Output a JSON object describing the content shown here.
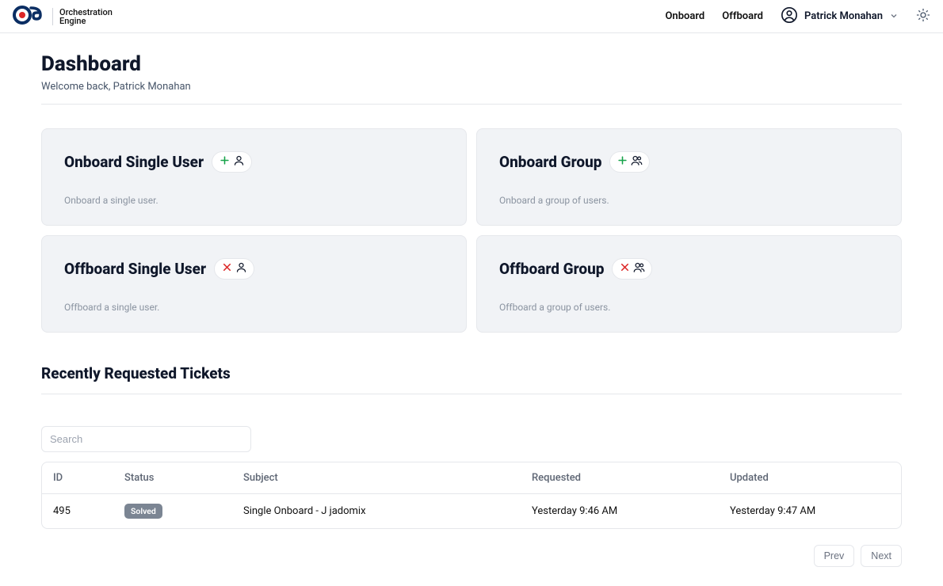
{
  "header": {
    "brand_line1": "Orchestration",
    "brand_line2": "Engine",
    "nav": {
      "onboard": "Onboard",
      "offboard": "Offboard"
    },
    "user_name": "Patrick Monahan"
  },
  "dashboard": {
    "title": "Dashboard",
    "subtitle": "Welcome back, Patrick Monahan"
  },
  "cards": {
    "onboard_single": {
      "title": "Onboard Single User",
      "desc": "Onboard a single user."
    },
    "onboard_group": {
      "title": "Onboard Group",
      "desc": "Onboard a group of users."
    },
    "offboard_single": {
      "title": "Offboard Single User",
      "desc": "Offboard a single user."
    },
    "offboard_group": {
      "title": "Offboard Group",
      "desc": "Offboard a group of users."
    }
  },
  "tickets": {
    "section_title": "Recently Requested Tickets",
    "search_placeholder": "Search",
    "columns": {
      "id": "ID",
      "status": "Status",
      "subject": "Subject",
      "requested": "Requested",
      "updated": "Updated"
    },
    "rows": [
      {
        "id": "495",
        "status": "Solved",
        "subject": "Single Onboard - J jadomix",
        "requested": "Yesterday 9:46 AM",
        "updated": "Yesterday 9:47 AM"
      }
    ],
    "prev": "Prev",
    "next": "Next"
  }
}
